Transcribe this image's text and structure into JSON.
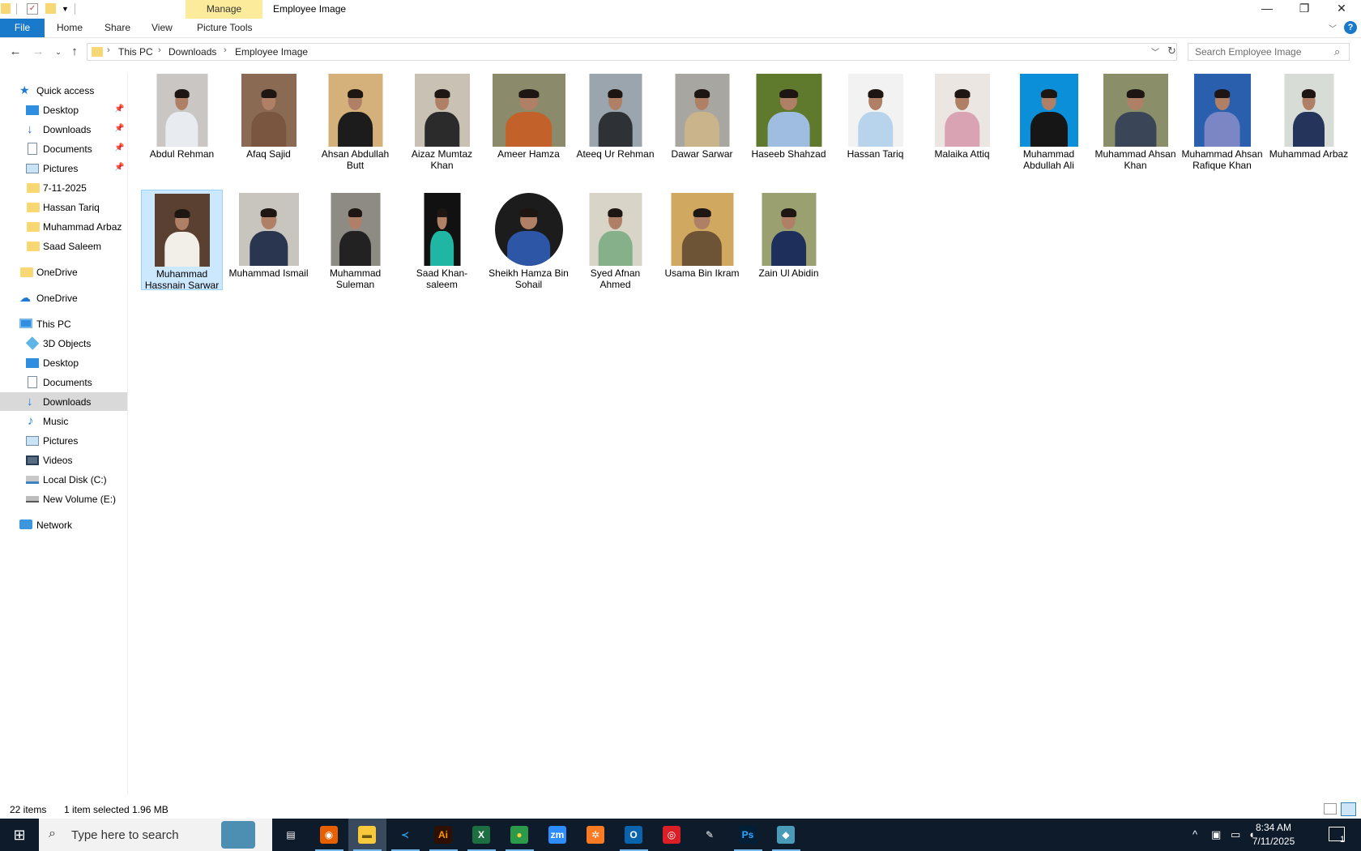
{
  "window": {
    "manage_label": "Manage",
    "title": "Employee Image",
    "controls": {
      "minimize": "—",
      "restore": "❐",
      "close": "✕"
    }
  },
  "ribbon": {
    "file": "File",
    "tabs": [
      "Home",
      "Share",
      "View",
      "Picture Tools"
    ],
    "help": "?"
  },
  "address": {
    "crumbs": [
      "This PC",
      "Downloads",
      "Employee Image"
    ],
    "search_placeholder": "Search Employee Image"
  },
  "sidebar": {
    "quick_access": "Quick access",
    "quick_items": [
      "Desktop",
      "Downloads",
      "Documents",
      "Pictures",
      "7-11-2025",
      "Hassan Tariq",
      "Muhammad Arbaz",
      "Saad Saleem"
    ],
    "onedrive_personal": "OneDrive",
    "onedrive": "OneDrive",
    "this_pc": "This PC",
    "pc_items": [
      "3D Objects",
      "Desktop",
      "Documents",
      "Downloads",
      "Music",
      "Pictures",
      "Videos",
      "Local Disk (C:)",
      "New Volume (E:)"
    ],
    "network": "Network"
  },
  "files": [
    {
      "name": "Abdul Rehman",
      "bg": "#c9c6c4",
      "shirt": "#e8ecf0"
    },
    {
      "name": "Afaq Sajid",
      "bg": "#8a6a52",
      "shirt": "#7a5540"
    },
    {
      "name": "Ahsan Abdullah Butt",
      "bg": "#d4b07a",
      "shirt": "#1c1c1c"
    },
    {
      "name": "Aizaz Mumtaz Khan",
      "bg": "#c9c2b4",
      "shirt": "#2b2b2b"
    },
    {
      "name": "Ameer Hamza",
      "bg": "#8b8a6a",
      "shirt": "#c2622a"
    },
    {
      "name": "Ateeq Ur Rehman",
      "bg": "#9aa5ae",
      "shirt": "#2e3236"
    },
    {
      "name": "Dawar Sarwar",
      "bg": "#a8a6a0",
      "shirt": "#c9b48c"
    },
    {
      "name": "Haseeb Shahzad",
      "bg": "#5f7a2c",
      "shirt": "#9fbde0"
    },
    {
      "name": "Hassan Tariq",
      "bg": "#f2f2f2",
      "shirt": "#b8d4ec"
    },
    {
      "name": "Malaika Attiq",
      "bg": "#ece6e2",
      "shirt": "#d9a3b4"
    },
    {
      "name": "Muhammad Abdullah Ali",
      "bg": "#0b8fd8",
      "shirt": "#161616"
    },
    {
      "name": "Muhammad Ahsan Khan",
      "bg": "#8a8f6a",
      "shirt": "#3a4658"
    },
    {
      "name": "Muhammad Ahsan Rafique Khan",
      "bg": "#2a5fae",
      "shirt": "#7a87c4"
    },
    {
      "name": "Muhammad Arbaz",
      "bg": "#d8dcd6",
      "shirt": "#24345a"
    },
    {
      "name": "Muhammad Hassnain Sarwar",
      "bg": "#5a4030",
      "shirt": "#f2efe8"
    },
    {
      "name": "Muhammad Ismail",
      "bg": "#c8c4be",
      "shirt": "#2a3550"
    },
    {
      "name": "Muhammad Suleman",
      "bg": "#8e8a84",
      "shirt": "#222222"
    },
    {
      "name": "Saad Khan-saleem",
      "bg": "#111111",
      "shirt": "#1fb6a4"
    },
    {
      "name": "Sheikh Hamza Bin Sohail",
      "bg": "#1c1c1c",
      "shirt": "#2e56a6"
    },
    {
      "name": "Syed Afnan Ahmed",
      "bg": "#d9d4c8",
      "shirt": "#86b08a"
    },
    {
      "name": "Usama Bin Ikram",
      "bg": "#d1a860",
      "shirt": "#6e5436"
    },
    {
      "name": "Zain Ul Abidin",
      "bg": "#9aa070",
      "shirt": "#1d2f5a"
    }
  ],
  "selected_index": 14,
  "status": {
    "count": "22 items",
    "selection": "1 item selected  1.96 MB"
  },
  "taskbar": {
    "search_text": "Type here to search",
    "apps": [
      "task-view",
      "firefox",
      "file-explorer",
      "vscode",
      "illustrator",
      "excel",
      "chrome",
      "zoom",
      "xampp",
      "outlook",
      "creative-cloud",
      "pen-tool",
      "photoshop",
      "app"
    ],
    "time": "8:34 AM",
    "date": "7/11/2025",
    "notifications": "1"
  }
}
